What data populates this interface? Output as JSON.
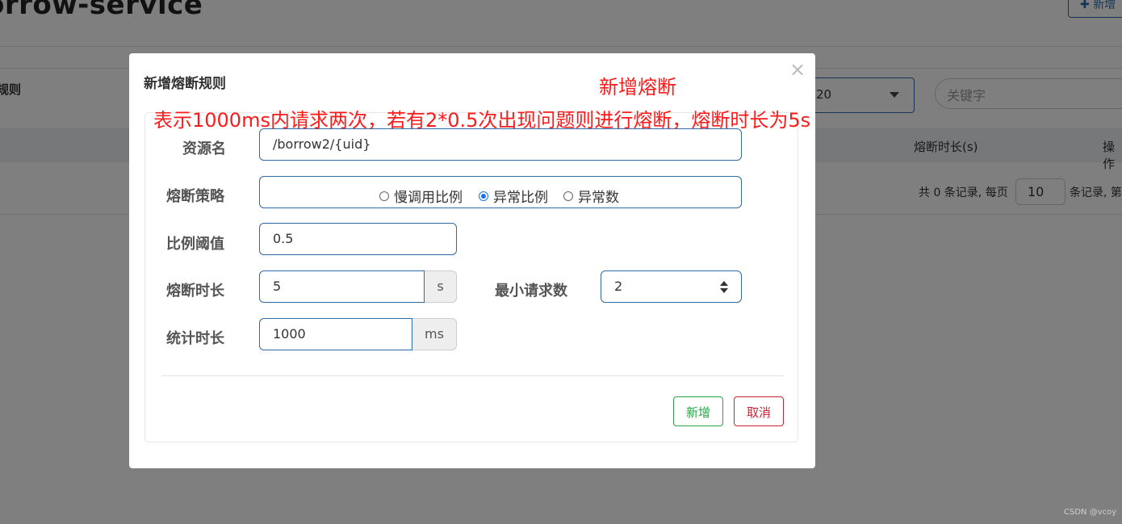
{
  "background": {
    "app_title": "orrow-service",
    "add_button": "新增",
    "rules_label": "规则",
    "select_value": "20",
    "search_placeholder": "关键字",
    "table_headers": [
      "熔断时长(s)",
      "操作"
    ],
    "pager": {
      "prefix": "共 0 条记录, 每页",
      "page_size": "10",
      "suffix": "条记录, 第"
    }
  },
  "modal": {
    "title": "新增熔断规则",
    "close_glyph": "×",
    "fields": {
      "resource": {
        "label": "资源名",
        "value": "/borrow2/{uid}"
      },
      "strategy": {
        "label": "熔断策略",
        "options": [
          "慢调用比例",
          "异常比例",
          "异常数"
        ],
        "selected": "异常比例"
      },
      "ratio_threshold": {
        "label": "比例阈值",
        "value": "0.5"
      },
      "break_duration": {
        "label": "熔断时长",
        "value": "5",
        "unit": "s"
      },
      "min_requests": {
        "label": "最小请求数",
        "value": "2"
      },
      "stat_duration": {
        "label": "统计时长",
        "value": "1000",
        "unit": "ms"
      }
    },
    "buttons": {
      "ok": "新增",
      "cancel": "取消"
    }
  },
  "annotations": {
    "heading": "新增熔断",
    "note": "表示1000ms内请求两次，若有2*0.5次出现问题则进行熔断，熔断时长为5s"
  },
  "watermark": "CSDN @vcoy",
  "colors": {
    "primary_border": "#2c6aa8",
    "annotation": "#ff1a1a",
    "ok_button": "#28a745",
    "cancel_button": "#c82333",
    "radio_checked": "#1a73e8"
  }
}
